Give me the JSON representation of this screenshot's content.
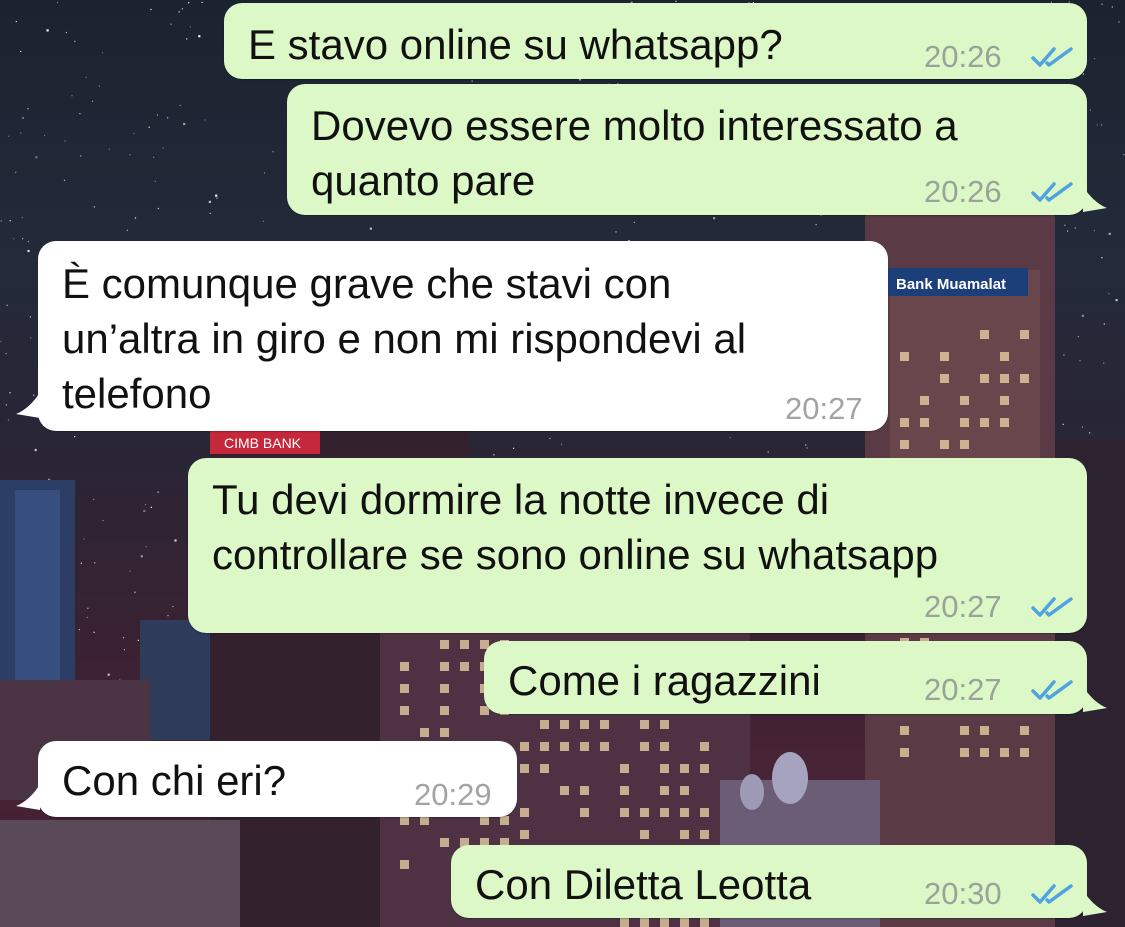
{
  "conversation": {
    "messages": [
      {
        "direction": "out",
        "text": "E stavo online su whatsapp?",
        "time": "20:26",
        "status": "read"
      },
      {
        "direction": "out",
        "text": "Dovevo essere molto interessato a\nquanto pare",
        "time": "20:26",
        "status": "read"
      },
      {
        "direction": "in",
        "text": "È comunque grave che stavi con\nun’altra in giro e non mi rispondevi al\ntelefono",
        "time": "20:27"
      },
      {
        "direction": "out",
        "text": "Tu devi dormire la notte invece di\ncontrollare se sono online su whatsapp",
        "time": "20:27",
        "status": "read"
      },
      {
        "direction": "out",
        "text": "Come i ragazzini",
        "time": "20:27",
        "status": "read"
      },
      {
        "direction": "in",
        "text": "Con chi eri?",
        "time": "20:29"
      },
      {
        "direction": "out",
        "text": "Con Diletta Leotta",
        "time": "20:30",
        "status": "read"
      }
    ]
  },
  "background": {
    "signs": [
      "Bank Muamalat",
      "CIMB BANK"
    ]
  },
  "colors": {
    "outgoing_bubble": "#dcf8c6",
    "incoming_bubble": "#ffffff",
    "read_ticks": "#4fa3e0",
    "timestamp": "#9aa39a"
  },
  "icons": {
    "read_status": "double-check-icon"
  }
}
